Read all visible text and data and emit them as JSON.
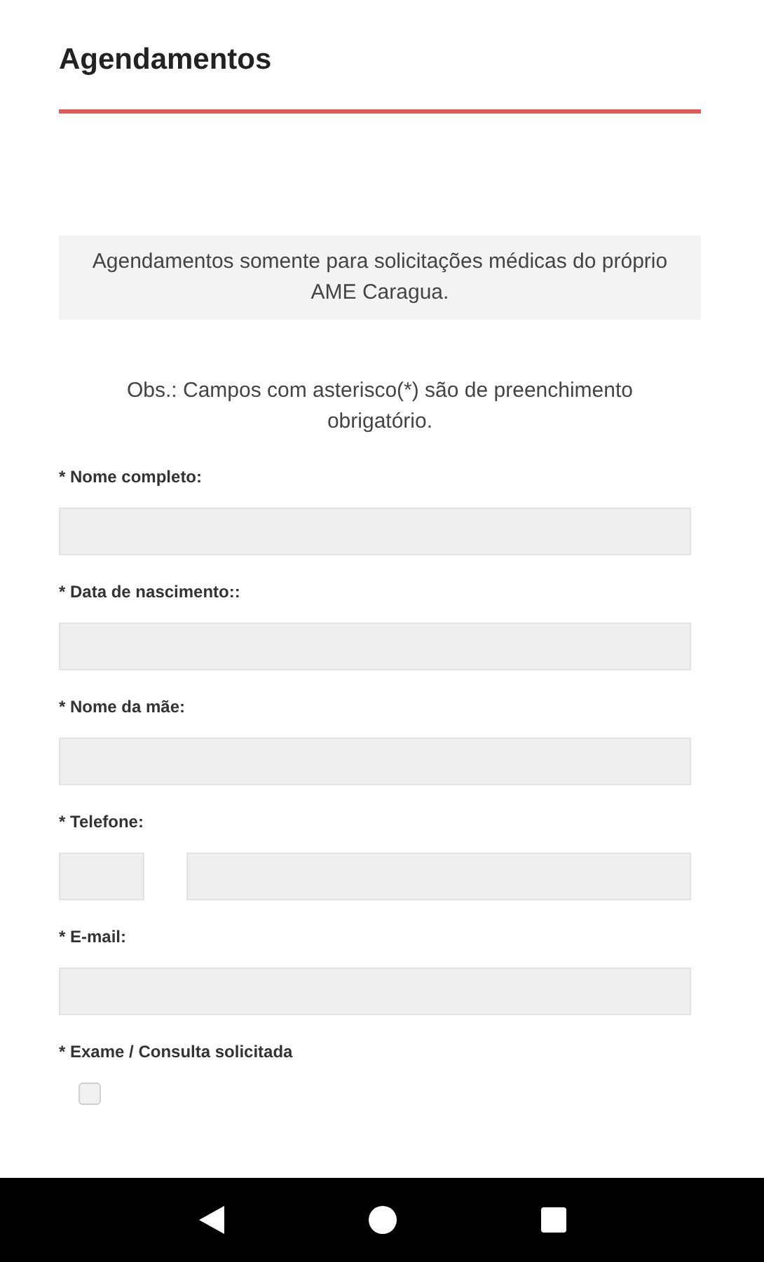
{
  "header": {
    "title": "Agendamentos"
  },
  "notice": "Agendamentos somente para solicitações médicas do próprio AME Caragua.",
  "note": "Obs.: Campos com asterisco(*) são de preenchimento obrigatório.",
  "fields": [
    {
      "kind": "text",
      "label": "* Nome completo:"
    },
    {
      "kind": "text",
      "label": "* Data de nascimento::"
    },
    {
      "kind": "text",
      "label": "* Nome da mãe:"
    },
    {
      "kind": "phone",
      "label": "* Telefone:"
    },
    {
      "kind": "text",
      "label": "* E-mail:"
    }
  ],
  "exam": {
    "label": "* Exame / Consulta solicitada",
    "options": [
      {
        "checked": false
      }
    ]
  }
}
